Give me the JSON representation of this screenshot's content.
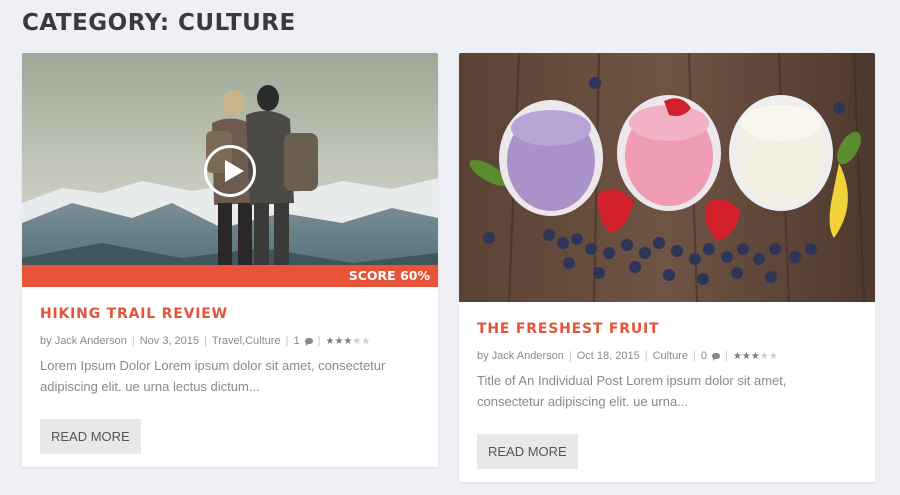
{
  "page": {
    "title": "CATEGORY: CULTURE"
  },
  "posts": [
    {
      "title": "HIKING TRAIL REVIEW",
      "score_label": "SCORE 60%",
      "has_video": true,
      "meta": {
        "by": "by",
        "author": "Jack Anderson",
        "date": "Nov 3, 2015",
        "category_1": "Travel",
        "category_sep": ", ",
        "category_2": "Culture",
        "comments": "1",
        "rating": 3,
        "rating_max": 5
      },
      "excerpt": "Lorem Ipsum Dolor Lorem ipsum dolor sit amet, consectetur adipiscing elit. ue urna lectus dictum...",
      "button": "READ MORE"
    },
    {
      "title": "THE FRESHEST FRUIT",
      "meta": {
        "by": "by",
        "author": "Jack Anderson",
        "date": "Oct 18, 2015",
        "category_1": "Culture",
        "comments": "0",
        "rating": 3,
        "rating_max": 5
      },
      "excerpt": "Title of An Individual Post Lorem ipsum dolor sit amet, consectetur adipiscing elit. ue urna...",
      "button": "READ MORE"
    }
  ],
  "colors": {
    "accent": "#e4543c",
    "score_bar": "#e8543a",
    "background": "#eef0f5"
  },
  "icons": {
    "play": "play-icon",
    "comment": "comment-icon",
    "star": "star-icon"
  }
}
